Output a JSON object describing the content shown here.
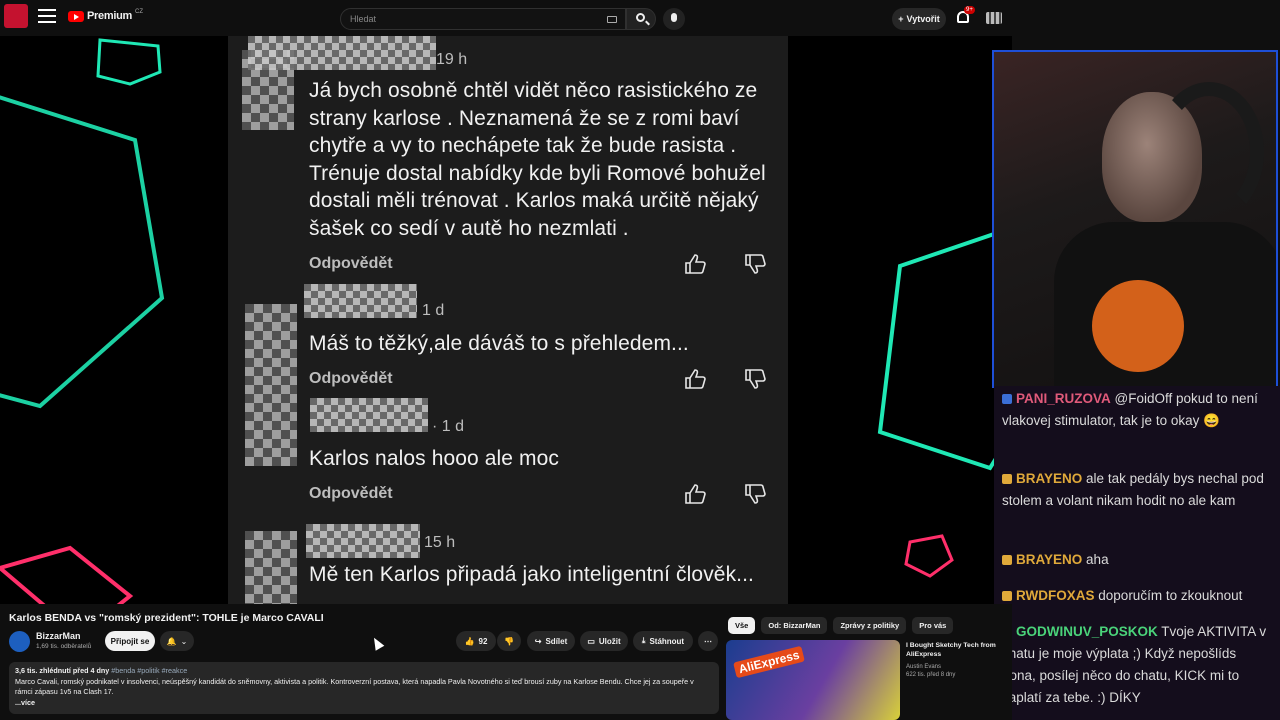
{
  "topbar": {
    "brand": "Premium",
    "country": "CZ",
    "search_placeholder": "Hledat",
    "create_label": "Vytvořit",
    "notifications": "9+"
  },
  "comments": [
    {
      "time": "19 h",
      "lines": [
        "Já bych osobně chtěl vidět něco rasistického ze",
        "strany karlose . Neznamená že se z romi baví",
        "chytře a vy to nechápete tak že bude rasista .",
        "Trénuje dostal nabídky kde byli Romové bohužel",
        "dostali měli trénovat . Karlos maká určitě nějaký",
        "šašek co sedí v autě ho nezmlati ."
      ],
      "reply": "Odpovědět"
    },
    {
      "time": "1 d",
      "lines": [
        "Máš to těžký,ale dáváš to s přehledem..."
      ],
      "reply": "Odpovědět"
    },
    {
      "time": "· 1 d",
      "lines": [
        "Karlos nalos hooo ale moc"
      ],
      "reply": "Odpovědět"
    },
    {
      "time": "15 h",
      "lines": [
        "Mě ten Karlos připadá jako inteligentní člověk..."
      ],
      "reply": ""
    }
  ],
  "chat": [
    {
      "user": "PANI_RUZOVA",
      "text": "@FoidOff pokud to není vlakovej stimulator, tak je to okay 😄",
      "color": "#e05a7a"
    },
    {
      "user": "BRAYENO",
      "text": "ale tak pedály bys nechal pod stolem a volant nikam hodit no ale kam",
      "color": "#e0a93a"
    },
    {
      "user": "BRAYENO",
      "text": "aha",
      "color": "#e0a93a"
    },
    {
      "user": "RWDFOXAS",
      "text": "doporučím to zkouknout",
      "color": "#e0a93a"
    },
    {
      "user": "GODWINUV_POSKOK",
      "text": "Tvoje AKTIVITA v chatu je moje výplata ;) Když nepošlíds dona, posílej něco do chatu, KICK mi to zaplatí za tebe. :) DÍKY",
      "color": "#4ad37a"
    }
  ],
  "video": {
    "title": "Karlos BENDA vs \"romský prezident\": TOHLE je Marco CAVALI",
    "channel": "BizzarMan",
    "subscribers": "1,69 tis. odběratelů",
    "subscribe_label": "Připojit se",
    "likes": "92",
    "share_label": "Sdílet",
    "save_label": "Uložit",
    "download_label": "Stáhnout",
    "views_date": "3,6 tis. zhlédnutí  před 4 dny",
    "tags": "#benda #politik #reakce",
    "description": "Marco Cavali, romský podnikatel v insolvenci, neúspěšný kandidát do sněmovny, aktivista a politik. Kontroverzní postava, která napadla Pavla Novotného si teď brousí zuby na Karlose Bendu. Chce jej za soupeře v rámci zápasu 1v5 na Clash 17.",
    "more": "...více"
  },
  "chips": [
    "Vše",
    "Od: BizzarMan",
    "Zprávy z politiky",
    "Pro vás"
  ],
  "recommended": {
    "title": "I Bought Sketchy Tech from AliExpress",
    "thumb_text": "AliExpress",
    "channel": "Austin Evans",
    "meta": "622 tis.  před 8 dny"
  },
  "colors": {
    "accent": "#ff0000",
    "stream_green": "#2ee6b0",
    "stream_pink": "#ff2f6a"
  }
}
